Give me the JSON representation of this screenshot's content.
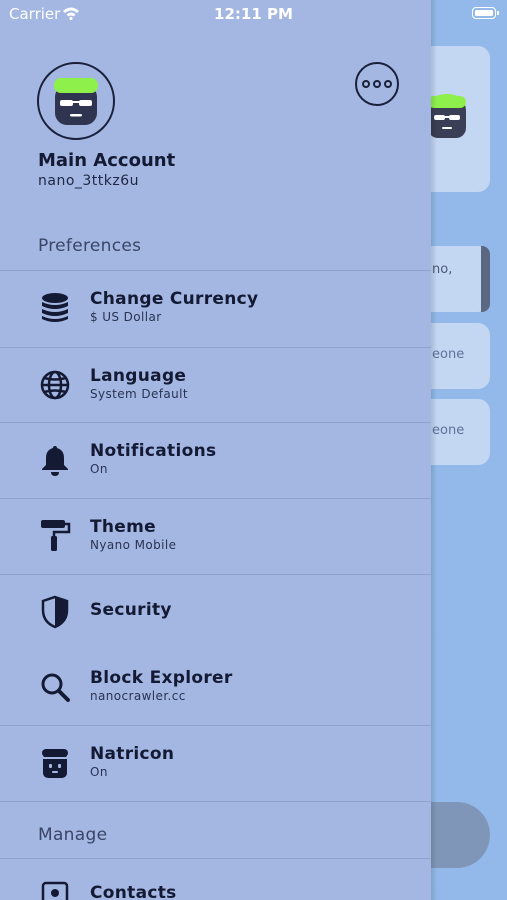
{
  "status_bar": {
    "carrier": "Carrier",
    "time": "12:11 PM"
  },
  "background": {
    "row_texts": [
      "no,",
      "eone",
      "eone"
    ]
  },
  "drawer": {
    "account": {
      "name": "Main Account",
      "address": "nano_3ttkz6u"
    },
    "sections": {
      "preferences": "Preferences",
      "manage": "Manage"
    },
    "items": [
      {
        "label": "Change Currency",
        "sub": "$ US Dollar",
        "icon": "database-icon"
      },
      {
        "label": "Language",
        "sub": "System Default",
        "icon": "globe-icon"
      },
      {
        "label": "Notifications",
        "sub": "On",
        "icon": "bell-icon"
      },
      {
        "label": "Theme",
        "sub": "Nyano Mobile",
        "icon": "paint-roller-icon"
      },
      {
        "label": "Security",
        "sub": "",
        "icon": "shield-icon"
      },
      {
        "label": "Block Explorer",
        "sub": "nanocrawler.cc",
        "icon": "search-icon"
      },
      {
        "label": "Natricon",
        "sub": "On",
        "icon": "natricon-icon"
      },
      {
        "label": "Contacts",
        "sub": "",
        "icon": "contact-card-icon"
      }
    ]
  },
  "colors": {
    "drawer_bg": "#a3b7e2",
    "app_bg": "#92b9ea",
    "text_dark": "#141a33",
    "natricon_hair": "#8ef04a"
  }
}
